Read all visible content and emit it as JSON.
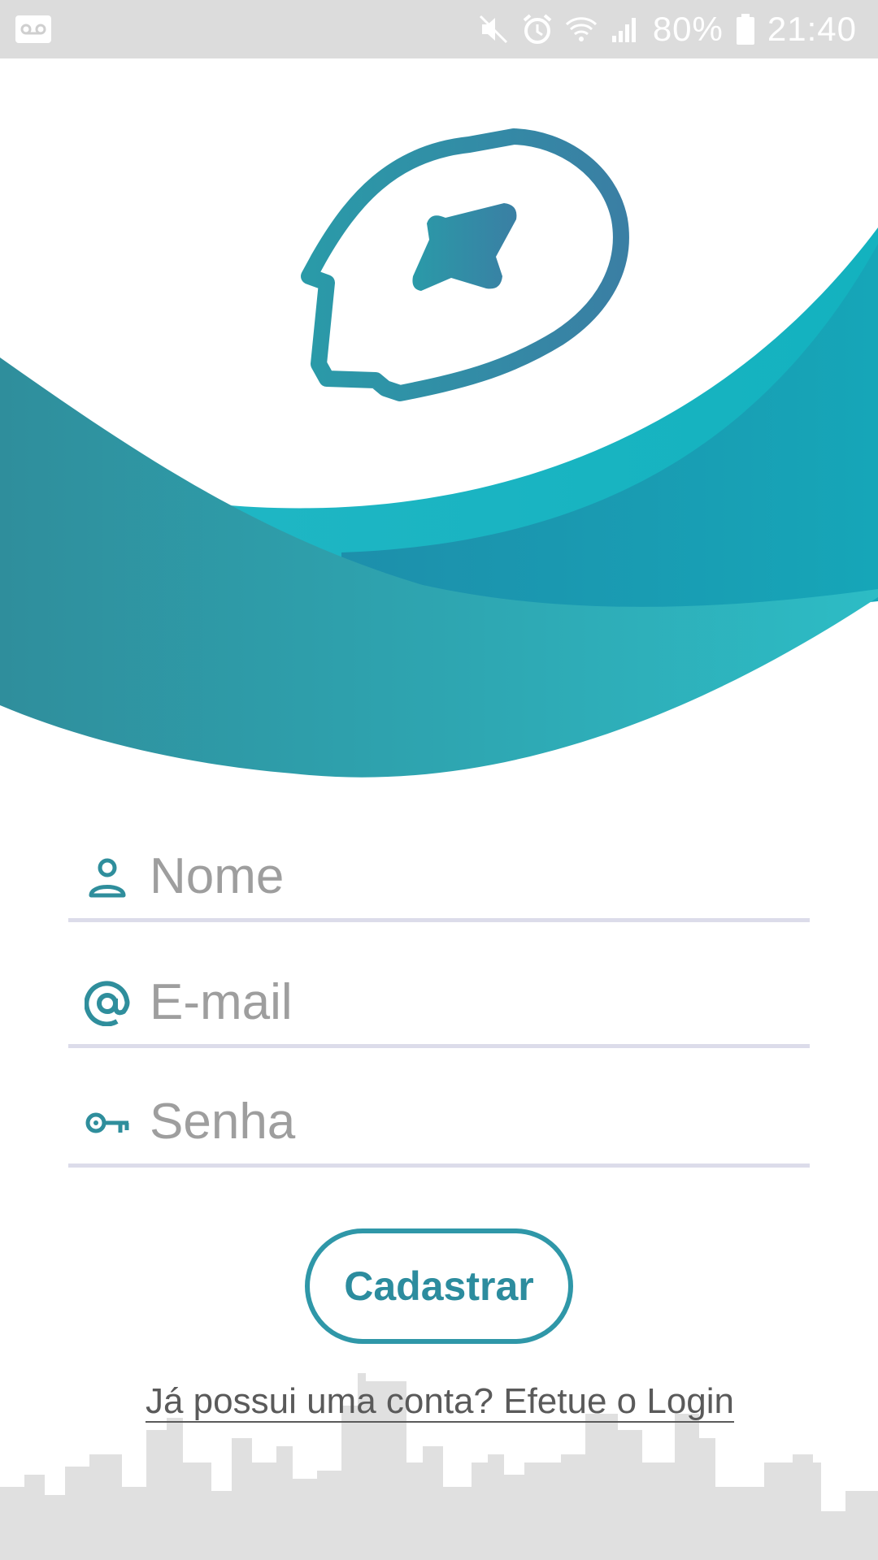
{
  "status_bar": {
    "battery": "80%",
    "time": "21:40",
    "icons": [
      "voicemail-icon",
      "mute-icon",
      "alarm-icon",
      "wifi-icon",
      "signal-icon",
      "battery-icon"
    ]
  },
  "hero": {
    "logo": "head-with-star-logo",
    "colors": {
      "teal_dark": "#2f8e9c",
      "teal_light": "#12b7c4",
      "teal_mid": "#1b94b0"
    }
  },
  "form": {
    "name": {
      "placeholder": "Nome",
      "value": "",
      "icon": "person-icon"
    },
    "email": {
      "placeholder": "E-mail",
      "value": "",
      "icon": "at-sign-icon"
    },
    "password": {
      "placeholder": "Senha",
      "value": "",
      "icon": "key-icon"
    }
  },
  "actions": {
    "register_label": "Cadastrar",
    "login_link": "Já possui uma conta? Efetue o Login"
  },
  "theme": {
    "accent": "#2f97a8",
    "underline": "#dcdcea",
    "skyline": "#e0e0e0"
  }
}
